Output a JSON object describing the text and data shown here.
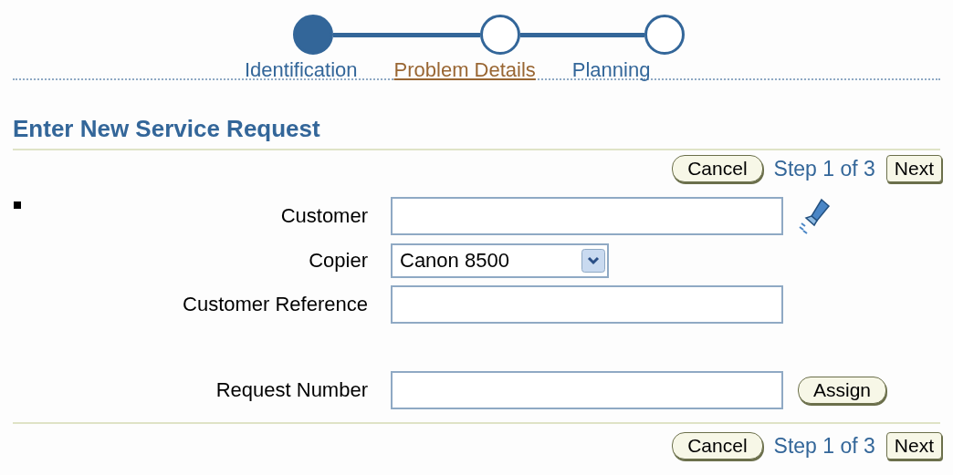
{
  "train": {
    "steps": [
      {
        "label": "Identification",
        "selected": true,
        "link": false
      },
      {
        "label": "Problem Details",
        "selected": false,
        "link": true
      },
      {
        "label": "Planning",
        "selected": false,
        "link": false
      }
    ]
  },
  "heading": "Enter New Service Request",
  "top_actions": {
    "cancel": "Cancel",
    "step": "Step 1 of 3",
    "next": "Next"
  },
  "fields": [
    {
      "kind": "text",
      "label": "Customer",
      "lookup": true
    },
    {
      "kind": "select",
      "label": "Copier",
      "value": "Canon 8500"
    },
    {
      "kind": "text",
      "label": "Customer Reference"
    },
    {
      "kind": "text",
      "label": "Request Number",
      "button": "Assign"
    }
  ],
  "bottom_actions": {
    "cancel": "Cancel",
    "step": "Step 1 of 3",
    "next": "Next"
  }
}
